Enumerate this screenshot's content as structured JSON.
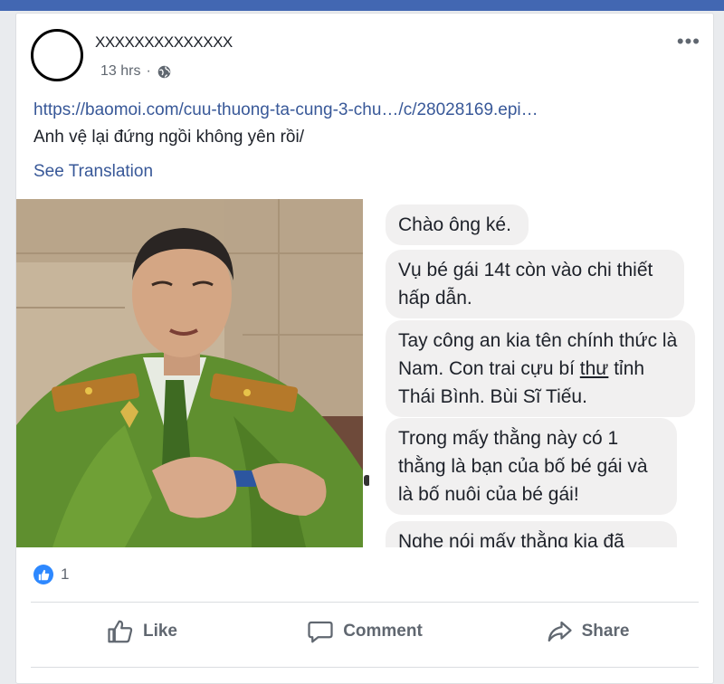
{
  "post": {
    "author": "XXXXXXXXXXXXXX",
    "time": "13 hrs",
    "time_separator": "·",
    "privacy_icon": "globe-icon",
    "more_label": "•••",
    "link": "https://baomoi.com/cuu-thuong-ta-cung-3-chu…/c/28028169.epi…",
    "text": "Anh vệ lại đứng ngồi không yên rồi/",
    "see_translation": "See Translation"
  },
  "chat_messages": [
    {
      "text": "Chào ông ké."
    },
    {
      "text": "Vụ bé gái 14t còn vào chi thiết hấp dẫn."
    },
    {
      "text_before": "Tay công an kia tên chính thức là Nam. Con trai cựu bí ",
      "underlined": "thư",
      "text_after": " tỉnh Thái Bình. Bùi Sĩ Tiếu."
    },
    {
      "text": "Trong mấy thằng này có 1 thằng là bạn của bố bé gái và là bố nuôi của bé gái!"
    },
    {
      "text": "Nghe nói mấy thằng kia đã"
    }
  ],
  "reactions": {
    "count": "1",
    "icon": "thumbs-up-icon"
  },
  "actions": {
    "like": "Like",
    "comment": "Comment",
    "share": "Share"
  },
  "colors": {
    "brand": "#4267b2",
    "link": "#385898",
    "like_badge": "#2d88ff",
    "bubble": "#f1f0f0"
  }
}
